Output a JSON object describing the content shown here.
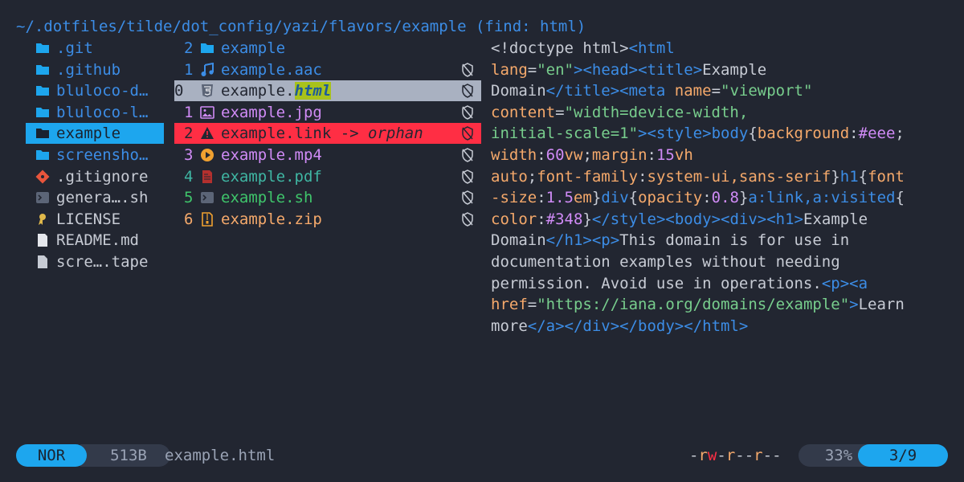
{
  "header": {
    "path": "~/.dotfiles/tilde/dot_config/yazi/flavors/example (find: html)"
  },
  "parent_items": [
    {
      "label": ".git",
      "icon": "git-folder-icon",
      "color": "#3c8de6"
    },
    {
      "label": ".github",
      "icon": "github-folder-icon",
      "color": "#3c8de6"
    },
    {
      "label": "bluloco-d…",
      "icon": "folder-icon",
      "color": "#3c8de6"
    },
    {
      "label": "bluloco-l…",
      "icon": "folder-icon",
      "color": "#3c8de6"
    },
    {
      "label": "example",
      "icon": "folder-icon",
      "color": "#1a2330",
      "selected": true
    },
    {
      "label": "screensho…",
      "icon": "folder-icon",
      "color": "#3c8de6"
    },
    {
      "label": ".gitignore",
      "icon": "git-icon",
      "color": "#c7cbd4"
    },
    {
      "label": "genera….sh",
      "icon": "terminal-icon",
      "color": "#c7cbd4"
    },
    {
      "label": "LICENSE",
      "icon": "license-icon",
      "color": "#c7cbd4"
    },
    {
      "label": "README.md",
      "icon": "markdown-icon",
      "color": "#c7cbd4"
    },
    {
      "label": "scre….tape",
      "icon": "file-icon",
      "color": "#c7cbd4"
    }
  ],
  "current_items": [
    {
      "num": "2",
      "label": "example",
      "icon": "folder-icon",
      "color": "#3c8de6",
      "numcolor": "#3c8de6",
      "lock": false
    },
    {
      "num": "1",
      "label": "example.aac",
      "icon": "music-icon",
      "color": "#3c8de6",
      "numcolor": "#3c8de6",
      "lock": true
    },
    {
      "num": "0",
      "label_pre": "example.",
      "label_hl": "html",
      "icon": "html-icon",
      "color": "#222631",
      "numcolor": "#222631",
      "lock": true,
      "hover": true
    },
    {
      "num": "1",
      "label": "example.jpg",
      "icon": "image-icon",
      "color": "#d08bf6",
      "numcolor": "#d08bf6",
      "lock": true
    },
    {
      "num": "2",
      "label_pre": "example.link -> ",
      "label_it": "orphan",
      "icon": "warning-icon",
      "color": "#222631",
      "numcolor": "#222631",
      "lock": true,
      "orphan": true
    },
    {
      "num": "3",
      "label": "example.mp4",
      "icon": "play-icon",
      "color": "#d08bf6",
      "numcolor": "#d08bf6",
      "lock": true
    },
    {
      "num": "4",
      "label": "example.pdf",
      "icon": "pdf-icon",
      "color": "#3fb6a3",
      "numcolor": "#3fb6a3",
      "lock": true
    },
    {
      "num": "5",
      "label": "example.sh",
      "icon": "terminal-icon",
      "color": "#3fc56b",
      "numcolor": "#3fc56b",
      "lock": true
    },
    {
      "num": "6",
      "label": "example.zip",
      "icon": "zip-icon",
      "color": "#f5a96b",
      "numcolor": "#f5a96b",
      "lock": true
    }
  ],
  "preview_lines": [
    [
      [
        "t-text",
        "<!doctype html>"
      ],
      [
        "t-tag",
        "<html"
      ]
    ],
    [
      [
        "t-attr",
        "lang"
      ],
      [
        "t-text",
        "="
      ],
      [
        "t-str",
        "\"en\""
      ],
      [
        "t-tag",
        ">"
      ],
      [
        "t-tag",
        "<head>"
      ],
      [
        "t-tag",
        "<title>"
      ],
      [
        "t-text",
        "Example"
      ]
    ],
    [
      [
        "t-text",
        "Domain"
      ],
      [
        "t-tag",
        "</title>"
      ],
      [
        "t-tag",
        "<meta "
      ],
      [
        "t-attr",
        "name"
      ],
      [
        "t-text",
        "="
      ],
      [
        "t-str",
        "\"viewport\""
      ]
    ],
    [
      [
        "t-attr",
        "content"
      ],
      [
        "t-text",
        "="
      ],
      [
        "t-str",
        "\"width=device-width,"
      ]
    ],
    [
      [
        "t-str",
        "initial-scale=1\""
      ],
      [
        "t-tag",
        ">"
      ],
      [
        "t-tag",
        "<style>"
      ],
      [
        "t-tag",
        "body"
      ],
      [
        "t-text",
        "{"
      ],
      [
        "t-css",
        "background"
      ],
      [
        "t-text",
        ":"
      ],
      [
        "t-val",
        "#eee"
      ],
      [
        "t-text",
        ";"
      ]
    ],
    [
      [
        "t-css",
        "width"
      ],
      [
        "t-text",
        ":"
      ],
      [
        "t-val",
        "60"
      ],
      [
        "t-css",
        "vw"
      ],
      [
        "t-text",
        ";"
      ],
      [
        "t-css",
        "margin"
      ],
      [
        "t-text",
        ":"
      ],
      [
        "t-val",
        "15"
      ],
      [
        "t-css",
        "vh"
      ]
    ],
    [
      [
        "t-css",
        "auto"
      ],
      [
        "t-text",
        ";"
      ],
      [
        "t-css",
        "font-family"
      ],
      [
        "t-text",
        ":"
      ],
      [
        "t-css",
        "system-ui,sans-serif"
      ],
      [
        "t-text",
        "}"
      ],
      [
        "t-tag",
        "h1"
      ],
      [
        "t-text",
        "{"
      ],
      [
        "t-css",
        "font"
      ]
    ],
    [
      [
        "t-css",
        "-size"
      ],
      [
        "t-text",
        ":"
      ],
      [
        "t-val",
        "1.5"
      ],
      [
        "t-css",
        "em"
      ],
      [
        "t-text",
        "}"
      ],
      [
        "t-tag",
        "div"
      ],
      [
        "t-text",
        "{"
      ],
      [
        "t-css",
        "opacity"
      ],
      [
        "t-text",
        ":"
      ],
      [
        "t-val",
        "0.8"
      ],
      [
        "t-text",
        "}"
      ],
      [
        "t-tag",
        "a:link,a:visited"
      ],
      [
        "t-text",
        "{"
      ]
    ],
    [
      [
        "t-css",
        "color"
      ],
      [
        "t-text",
        ":"
      ],
      [
        "t-val",
        "#348"
      ],
      [
        "t-text",
        "}"
      ],
      [
        "t-tag",
        "</style>"
      ],
      [
        "t-tag",
        "<body>"
      ],
      [
        "t-tag",
        "<div>"
      ],
      [
        "t-tag",
        "<h1>"
      ],
      [
        "t-text",
        "Example"
      ]
    ],
    [
      [
        "t-text",
        "Domain"
      ],
      [
        "t-tag",
        "</h1>"
      ],
      [
        "t-tag",
        "<p>"
      ],
      [
        "t-text",
        "This domain is for use in"
      ]
    ],
    [
      [
        "t-text",
        "documentation examples without needing"
      ]
    ],
    [
      [
        "t-text",
        "permission. Avoid use in operations."
      ],
      [
        "t-tag",
        "<p>"
      ],
      [
        "t-tag",
        "<a"
      ]
    ],
    [
      [
        "t-attr",
        "href"
      ],
      [
        "t-text",
        "="
      ],
      [
        "t-str",
        "\"https://iana.org/domains/example\""
      ],
      [
        "t-tag",
        ">"
      ],
      [
        "t-text",
        "Learn"
      ]
    ],
    [
      [
        "t-text",
        "more"
      ],
      [
        "t-tag",
        "</a>"
      ],
      [
        "t-tag",
        "</div>"
      ],
      [
        "t-tag",
        "</body>"
      ],
      [
        "t-tag",
        "</html>"
      ]
    ]
  ],
  "status": {
    "mode": "NOR",
    "size": "513B",
    "filename": "example.html",
    "perms": [
      [
        "-",
        "#c7cbd4"
      ],
      [
        "r",
        "#f5a96b"
      ],
      [
        "w",
        "#ff2e44"
      ],
      [
        "-",
        "#c7cbd4"
      ],
      [
        "r",
        "#f5a96b"
      ],
      [
        "-",
        "#c7cbd4"
      ],
      [
        "-",
        "#c7cbd4"
      ],
      [
        "r",
        "#f5a96b"
      ],
      [
        "-",
        "#c7cbd4"
      ],
      [
        "-",
        "#c7cbd4"
      ]
    ],
    "percent": "33%",
    "position": "3/9"
  },
  "colors": {
    "accent": "#1da6ee",
    "bg": "#222631",
    "orphan": "#ff2e44"
  }
}
